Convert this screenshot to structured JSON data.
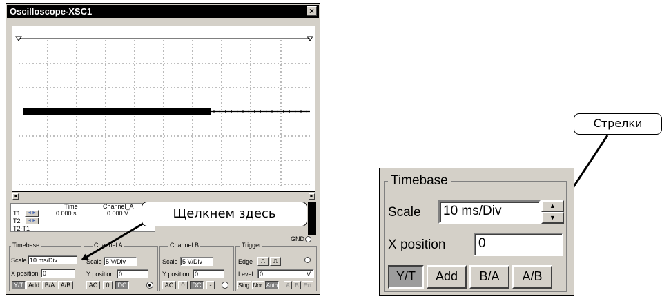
{
  "window": {
    "title": "Oscilloscope-XSC1",
    "close_label": "×"
  },
  "cursors": {
    "t1": "T1",
    "t2": "T2",
    "t2_t1": "T2-T1"
  },
  "readout": {
    "time_header": "Time",
    "time_value": "0.000 s",
    "channel_a_header": "Channel_A",
    "channel_a_value": "0.000 V"
  },
  "gnd_label": "GND",
  "timebase": {
    "title": "Timebase",
    "scale_label": "Scale",
    "scale_value": "10 ms/Div",
    "xpos_label": "X position",
    "xpos_value": "0",
    "modes": [
      "Y/T",
      "Add",
      "B/A",
      "A/B"
    ]
  },
  "channel_a": {
    "title": "Channel A",
    "scale_label": "Scale",
    "scale_value": "5 V/Div",
    "ypos_label": "Y position",
    "ypos_value": "0",
    "coupling": [
      "AC",
      "0",
      "DC"
    ]
  },
  "channel_b": {
    "title": "Channel B",
    "scale_label": "Scale",
    "scale_value": "5 V/Div",
    "ypos_label": "Y position",
    "ypos_value": "0",
    "coupling": [
      "AC",
      "0",
      "DC",
      "-"
    ]
  },
  "trigger": {
    "title": "Trigger",
    "edge_label": "Edge",
    "level_label": "Level",
    "level_value": "0",
    "level_unit": "V",
    "modes": [
      "Sing.",
      "Nor.",
      "Auto"
    ],
    "sources": [
      "A",
      "B",
      "Ext"
    ]
  },
  "callouts": {
    "click_here": "Щелкнем здесь",
    "arrows": "Стрелки"
  },
  "zoom": {
    "title": "Timebase",
    "scale_label": "Scale",
    "scale_value": "10 ms/Div",
    "xpos_label": "X position",
    "xpos_value": "0",
    "modes": [
      "Y/T",
      "Add",
      "B/A",
      "A/B"
    ],
    "up_arrow": "▲",
    "down_arrow": "▼"
  }
}
